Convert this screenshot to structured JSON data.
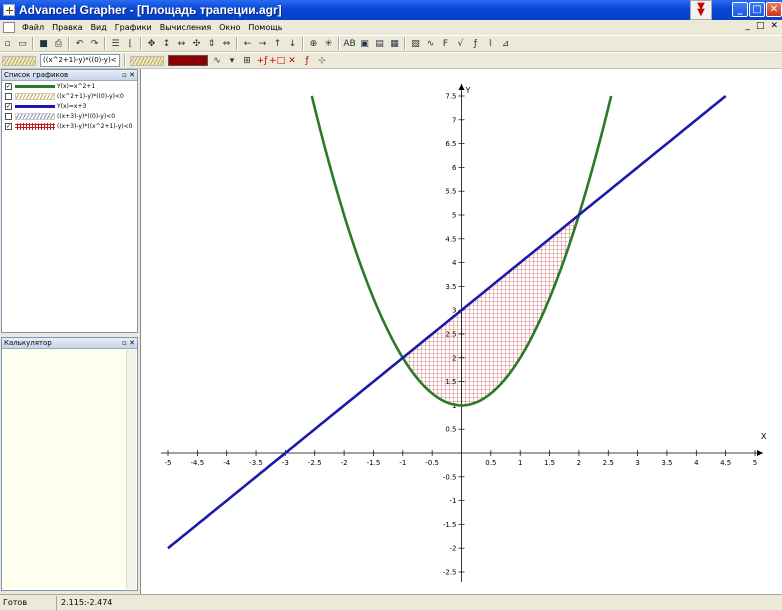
{
  "window": {
    "title": "Advanced Grapher - [Площадь трапеции.agr]",
    "min_label": "_",
    "max_label": "□",
    "close_label": "✕",
    "badge_label": "▼"
  },
  "menu": {
    "items": [
      "Файл",
      "Правка",
      "Вид",
      "Графики",
      "Вычисления",
      "Окно",
      "Помощь"
    ],
    "mdi_controls": [
      "_",
      "□",
      "✕"
    ]
  },
  "toolbar": {
    "formula_select": "((x^2+1)-y)*((0)-y)<",
    "icons_row1": [
      "new-icon",
      "open-icon",
      "save-icon",
      "print-icon",
      "undo-icon",
      "redo-icon",
      "list-icon",
      "axes-icon",
      "move-icon",
      "updown-icon",
      "leftright-icon",
      "pan-icon",
      "vscale-icon",
      "hscale-icon",
      "arrow-left-icon",
      "arrow-right-icon",
      "arrow-up-icon",
      "arrow-down-icon",
      "crosshair-icon",
      "snap-icon",
      "label-icon",
      "frame-icon",
      "grid-icon",
      "table-icon",
      "derivative-icon",
      "integral-icon",
      "function-icon",
      "tangent-icon",
      "fx-icon",
      "plot-icon",
      "area-icon"
    ],
    "glyphs_row1": [
      "▫",
      "▭",
      "■",
      "⎙",
      "↶",
      "↷",
      "☰",
      "⌊",
      "✥",
      "↕",
      "↔",
      "✣",
      "⇕",
      "⇔",
      "←",
      "→",
      "↑",
      "↓",
      "⊕",
      "✳",
      "AB",
      "▣",
      "▤",
      "▦",
      "▧",
      "∿",
      "F",
      "√",
      "ƒ",
      "⌇",
      "⊿"
    ],
    "icons_row2": [
      "line-style-icon",
      "color-icon",
      "options-icon",
      "add-graph-icon",
      "add-point-icon",
      "delete-icon",
      "edit-icon",
      "trace-icon"
    ],
    "glyphs_row2": [
      "∿",
      "▾",
      "⊞",
      "+ƒ",
      "+□",
      "✕",
      "ƒ",
      "⊹"
    ]
  },
  "graph_list": {
    "header": "Список графиков",
    "items": [
      {
        "checked": true,
        "label": "Y(x)=x^2+1",
        "style": "line",
        "color": "#2a7a2a"
      },
      {
        "checked": false,
        "label": "((x^2+1)-y)*((0)-y)<0",
        "style": "hatch",
        "color": "#c8a838"
      },
      {
        "checked": true,
        "label": "Y(x)=x+3",
        "style": "line",
        "color": "#1a1aa8"
      },
      {
        "checked": false,
        "label": "((x+3)-y)*((0)-y)<0",
        "style": "hatch",
        "color": "#8a8aa8"
      },
      {
        "checked": true,
        "label": "((x+3)-y)*((x^2+1)-y)<0",
        "style": "grid",
        "color": "#c02020"
      }
    ]
  },
  "calculator": {
    "header": "Калькулятор"
  },
  "status": {
    "state": "Готов",
    "coords": "2.115:-2.474"
  },
  "chart_data": {
    "type": "line",
    "x_axis_label": "X",
    "y_axis_label": "Y",
    "xlim": [
      -5,
      5
    ],
    "ylim": [
      -2.5,
      7.5
    ],
    "x_ticks": [
      -5,
      -4.5,
      -4,
      -3.5,
      -3,
      -2.5,
      -2,
      -1.5,
      -1,
      -0.5,
      0.5,
      1,
      1.5,
      2,
      2.5,
      3,
      3.5,
      4,
      4.5,
      5
    ],
    "y_ticks": [
      -2.5,
      -2,
      -1.5,
      -1,
      -0.5,
      0.5,
      1,
      1.5,
      2,
      2.5,
      3,
      3.5,
      4,
      4.5,
      5,
      5.5,
      6,
      6.5,
      7,
      7.5
    ],
    "series": [
      {
        "name": "Y(x)=x^2+1",
        "kind": "function",
        "expr": "x^2+1",
        "domain": [
          -2.55,
          2.55
        ],
        "color": "#2a7a2a"
      },
      {
        "name": "Y(x)=x+3",
        "kind": "function",
        "expr": "x+3",
        "domain": [
          -5,
          4.5
        ],
        "color": "#1a1aa8"
      },
      {
        "name": "((x+3)-y)*((x^2+1)-y)<0",
        "kind": "region",
        "between": [
          "x^2+1",
          "x+3"
        ],
        "domain": [
          -1,
          2
        ],
        "color": "#c02020"
      }
    ],
    "grid": false
  }
}
